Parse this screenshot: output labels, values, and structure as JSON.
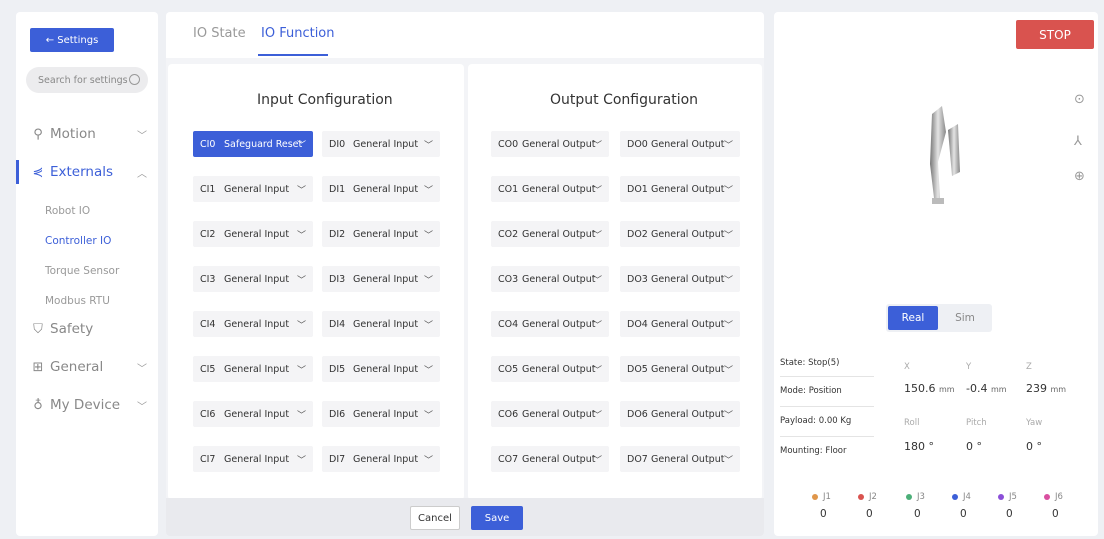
{
  "sidebar": {
    "back_label": "← Settings",
    "search_placeholder": "Search for settings",
    "nav": [
      {
        "label": "Motion",
        "chevron": "﹀"
      },
      {
        "label": "Externals",
        "chevron": "︿"
      },
      {
        "label": "Safety"
      },
      {
        "label": "General",
        "chevron": "﹀"
      },
      {
        "label": "My Device",
        "chevron": "﹀"
      }
    ],
    "sub_items": [
      "Robot IO",
      "Controller IO",
      "Torque Sensor",
      "Modbus RTU"
    ]
  },
  "tabs": [
    "IO State",
    "IO Function"
  ],
  "input_title": "Input Configuration",
  "output_title": "Output Configuration",
  "ci": [
    {
      "pin": "CI0",
      "value": "Safeguard Reset"
    },
    {
      "pin": "CI1",
      "value": "General Input"
    },
    {
      "pin": "CI2",
      "value": "General Input"
    },
    {
      "pin": "CI3",
      "value": "General Input"
    },
    {
      "pin": "CI4",
      "value": "General Input"
    },
    {
      "pin": "CI5",
      "value": "General Input"
    },
    {
      "pin": "CI6",
      "value": "General Input"
    },
    {
      "pin": "CI7",
      "value": "General Input"
    }
  ],
  "di": [
    {
      "pin": "DI0",
      "value": "General Input"
    },
    {
      "pin": "DI1",
      "value": "General Input"
    },
    {
      "pin": "DI2",
      "value": "General Input"
    },
    {
      "pin": "DI3",
      "value": "General Input"
    },
    {
      "pin": "DI4",
      "value": "General Input"
    },
    {
      "pin": "DI5",
      "value": "General Input"
    },
    {
      "pin": "DI6",
      "value": "General Input"
    },
    {
      "pin": "DI7",
      "value": "General Input"
    }
  ],
  "co": [
    {
      "pin": "CO0",
      "value": "General Output"
    },
    {
      "pin": "CO1",
      "value": "General Output"
    },
    {
      "pin": "CO2",
      "value": "General Output"
    },
    {
      "pin": "CO3",
      "value": "General Output"
    },
    {
      "pin": "CO4",
      "value": "General Output"
    },
    {
      "pin": "CO5",
      "value": "General Output"
    },
    {
      "pin": "CO6",
      "value": "General Output"
    },
    {
      "pin": "CO7",
      "value": "General Output"
    }
  ],
  "do": [
    {
      "pin": "DO0",
      "value": "General Output"
    },
    {
      "pin": "DO1",
      "value": "General Output"
    },
    {
      "pin": "DO2",
      "value": "General Output"
    },
    {
      "pin": "DO3",
      "value": "General Output"
    },
    {
      "pin": "DO4",
      "value": "General Output"
    },
    {
      "pin": "DO5",
      "value": "General Output"
    },
    {
      "pin": "DO6",
      "value": "General Output"
    },
    {
      "pin": "DO7",
      "value": "General Output"
    }
  ],
  "chevron": "﹀",
  "footer": {
    "cancel": "Cancel",
    "save": "Save"
  },
  "right": {
    "stop": "STOP",
    "real": "Real",
    "sim": "Sim",
    "state": "State: Stop(5)",
    "mode": "Mode: Position",
    "payload": "Payload: 0.00 Kg",
    "mounting": "Mounting: Floor",
    "pos_headers": [
      "X",
      "Y",
      "Z"
    ],
    "pos_values": [
      "150.6",
      "-0.4",
      "239"
    ],
    "pos_unit": "mm",
    "rot_headers": [
      "Roll",
      "Pitch",
      "Yaw"
    ],
    "rot_values": [
      "180 °",
      "0 °",
      "0 °"
    ],
    "joints": [
      {
        "label": "J1",
        "value": "0",
        "color": "#e0964a"
      },
      {
        "label": "J2",
        "value": "0",
        "color": "#d9534f"
      },
      {
        "label": "J3",
        "value": "0",
        "color": "#4caf78"
      },
      {
        "label": "J4",
        "value": "0",
        "color": "#3c5fd8"
      },
      {
        "label": "J5",
        "value": "0",
        "color": "#8b4fd8"
      },
      {
        "label": "J6",
        "value": "0",
        "color": "#d94fa0"
      }
    ]
  },
  "colors": {
    "accent": "#3c5fd8",
    "stop": "#d9534f"
  }
}
